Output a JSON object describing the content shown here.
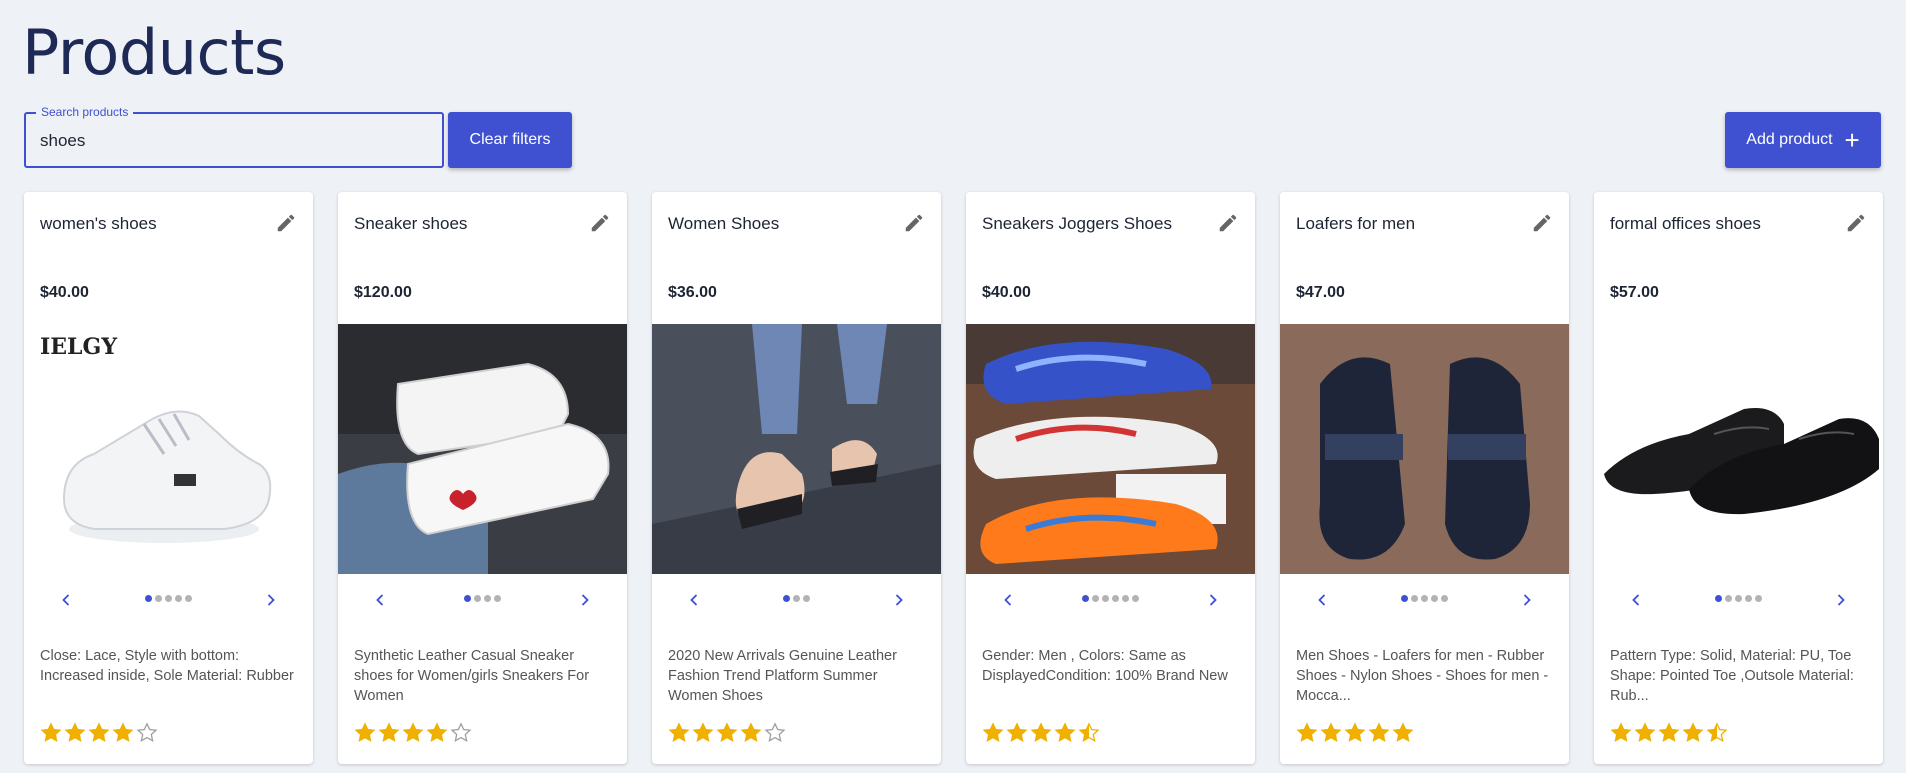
{
  "header": {
    "title": "Products"
  },
  "search": {
    "label": "Search products",
    "value": "shoes"
  },
  "buttons": {
    "clear": "Clear filters",
    "add": "Add product"
  },
  "colors": {
    "accent": "#3f51d1",
    "star": "#f0b000",
    "background": "#eef1f6"
  },
  "products": [
    {
      "title": "women's shoes",
      "price": "$40.00",
      "image_caption": "IELGY",
      "description": "Close: Lace, Style with bottom: Increased inside, Sole Material: Rubber",
      "rating": 4,
      "image_count": 5,
      "active_image": 0
    },
    {
      "title": "Sneaker shoes",
      "price": "$120.00",
      "description": "Synthetic Leather Casual Sneaker shoes for Women/girls Sneakers For Women",
      "rating": 4,
      "image_count": 4,
      "active_image": 0
    },
    {
      "title": "Women Shoes",
      "price": "$36.00",
      "description": "2020 New Arrivals Genuine Leather Fashion Trend Platform Summer Women Shoes",
      "rating": 4,
      "image_count": 3,
      "active_image": 0
    },
    {
      "title": "Sneakers Joggers Shoes",
      "price": "$40.00",
      "description": "Gender: Men , Colors: Same as DisplayedCondition: 100% Brand New",
      "rating": 4.5,
      "image_count": 6,
      "active_image": 0
    },
    {
      "title": "Loafers for men",
      "price": "$47.00",
      "description": "Men Shoes - Loafers for men - Rubber Shoes - Nylon Shoes - Shoes for men - Mocca...",
      "rating": 5,
      "image_count": 5,
      "active_image": 0
    },
    {
      "title": "formal offices shoes",
      "price": "$57.00",
      "description": "Pattern Type: Solid, Material: PU, Toe Shape: Pointed Toe ,Outsole Material: Rub...",
      "rating": 4.5,
      "image_count": 5,
      "active_image": 0
    }
  ],
  "icons": {
    "edit": "pencil-icon",
    "prev": "chevron-left-icon",
    "next": "chevron-right-icon",
    "add": "plus-icon",
    "rating": "star-icon"
  }
}
